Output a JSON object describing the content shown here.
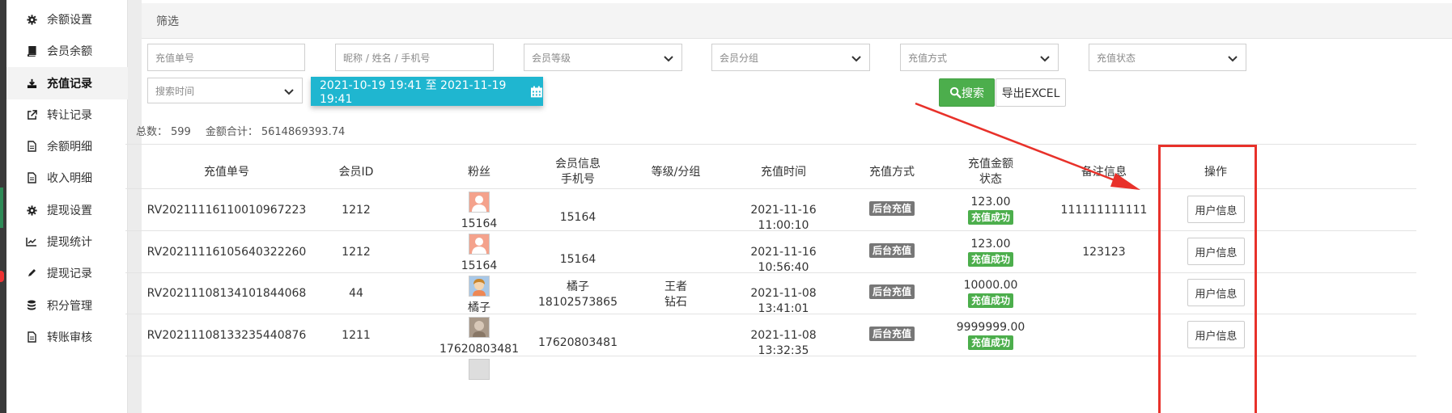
{
  "sidebar": {
    "items": [
      {
        "label": "余额设置",
        "icon": "gear-icon"
      },
      {
        "label": "会员余额",
        "icon": "book-icon"
      },
      {
        "label": "充值记录",
        "icon": "download-icon",
        "active": true
      },
      {
        "label": "转让记录",
        "icon": "external-link-icon"
      },
      {
        "label": "余额明细",
        "icon": "file-icon"
      },
      {
        "label": "收入明细",
        "icon": "file-icon"
      },
      {
        "label": "提现设置",
        "icon": "gear-icon"
      },
      {
        "label": "提现统计",
        "icon": "line-chart-icon"
      },
      {
        "label": "提现记录",
        "icon": "pencil-icon"
      },
      {
        "label": "积分管理",
        "icon": "database-icon"
      },
      {
        "label": "转账审核",
        "icon": "file-icon"
      }
    ]
  },
  "filter": {
    "title": "筛选",
    "recharge_no_placeholder": "充值单号",
    "member_placeholder": "昵称 / 姓名 / 手机号",
    "level_select": "会员等级",
    "group_select": "会员分组",
    "method_select": "充值方式",
    "status_select": "充值状态",
    "time_select": "搜索时间",
    "date_range": "2021-10-19 19:41 至 2021-11-19 19:41",
    "search_label": "搜索",
    "export_label": "导出EXCEL"
  },
  "summary": {
    "total_label": "总数：",
    "total_value": "599",
    "amount_label": "金额合计：",
    "amount_value": "5614869393.74"
  },
  "table": {
    "headers": {
      "order_no": "充值单号",
      "member_id": "会员ID",
      "fans": "粉丝",
      "member_info_1": "会员信息",
      "member_info_2": "手机号",
      "level_group": "等级/分组",
      "time": "充值时间",
      "method": "充值方式",
      "amount_1": "充值金额",
      "amount_2": "状态",
      "remark": "备注信息",
      "ops": "操作"
    },
    "rows": [
      {
        "order_no": "RV20211116110010967223",
        "member_id": "1212",
        "fan_name": "15164",
        "info_name": "",
        "info_phone": "15164",
        "level": "",
        "group": "",
        "time": "2021-11-16 11:00:10",
        "method": "后台充值",
        "amount": "123.00",
        "status": "充值成功",
        "remark": "111111111111",
        "op": "用户信息",
        "avatar_color": "#f4a28c"
      },
      {
        "order_no": "RV20211116105640322260",
        "member_id": "1212",
        "fan_name": "15164",
        "info_name": "",
        "info_phone": "15164",
        "level": "",
        "group": "",
        "time": "2021-11-16 10:56:40",
        "method": "后台充值",
        "amount": "123.00",
        "status": "充值成功",
        "remark": "123123",
        "op": "用户信息",
        "avatar_color": "#f4a28c"
      },
      {
        "order_no": "RV20211108134101844068",
        "member_id": "44",
        "fan_name": "橘子",
        "info_name": "橘子",
        "info_phone": "18102573865",
        "level": "王者",
        "group": "钻石",
        "time": "2021-11-08 13:41:01",
        "method": "后台充值",
        "amount": "10000.00",
        "status": "充值成功",
        "remark": "",
        "op": "用户信息",
        "avatar_color": "#c8a060"
      },
      {
        "order_no": "RV20211108133235440876",
        "member_id": "1211",
        "fan_name": "17620803481",
        "info_name": "",
        "info_phone": "17620803481",
        "level": "",
        "group": "",
        "time": "2021-11-08 13:32:35",
        "method": "后台充值",
        "amount": "9999999.00",
        "status": "充值成功",
        "remark": "",
        "op": "用户信息",
        "avatar_color": "#a89888"
      }
    ]
  },
  "colors": {
    "accent_cyan": "#1fb6d0",
    "success_green": "#4cae4c",
    "annotation_red": "#e8312a"
  }
}
